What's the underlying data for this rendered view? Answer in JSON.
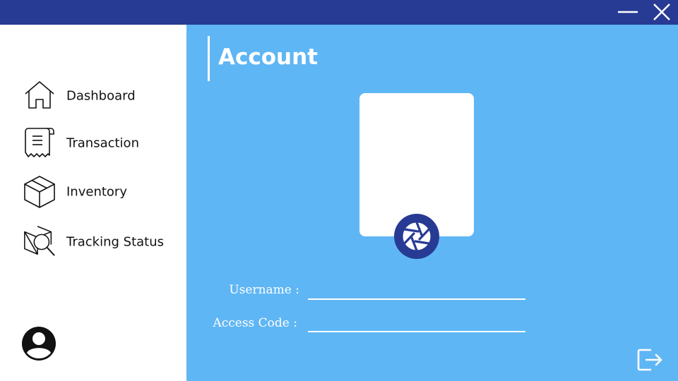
{
  "window": {
    "controls": {
      "minimize_icon": "minimize-icon",
      "close_icon": "close-icon"
    }
  },
  "sidebar": {
    "items": [
      {
        "label": "Dashboard",
        "icon": "home-icon"
      },
      {
        "label": "Transaction",
        "icon": "receipt-icon"
      },
      {
        "label": "Inventory",
        "icon": "box-icon"
      },
      {
        "label": "Tracking Status",
        "icon": "package-search-icon"
      }
    ],
    "avatar_icon": "user-avatar-icon"
  },
  "main": {
    "title": "Account",
    "photo": {
      "camera_icon": "camera-shutter-icon"
    },
    "form": {
      "username_label": "Username :",
      "username_value": "",
      "access_code_label": "Access Code :",
      "access_code_value": ""
    },
    "logout_icon": "logout-icon"
  },
  "colors": {
    "titlebar": "#273b94",
    "main_bg": "#5fb6f5",
    "accent_dark": "#273b94",
    "sidebar_bg": "#ffffff"
  }
}
